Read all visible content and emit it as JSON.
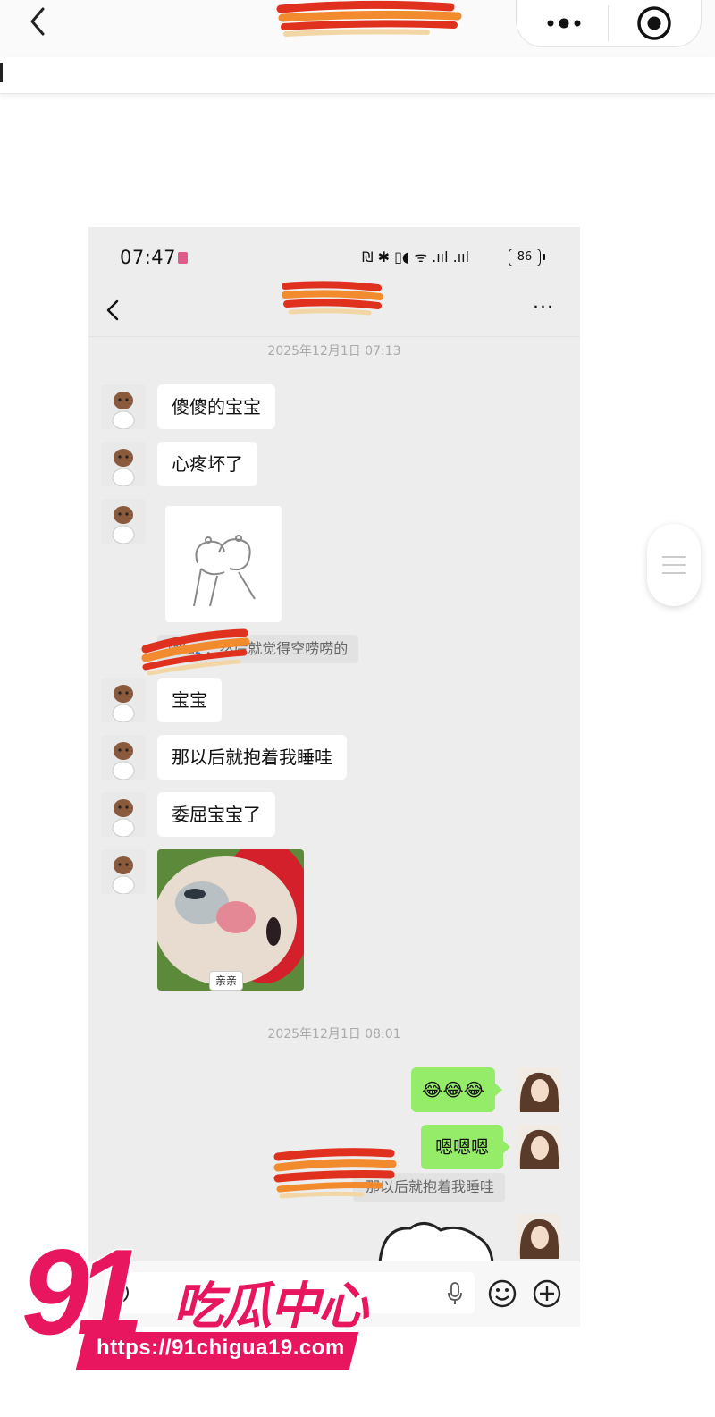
{
  "outer": {
    "capsule_more": "•●•",
    "colors": {
      "redact_red": "#e0301e",
      "redact_orange": "#f28a2e",
      "redact_cream": "#f3d6a6"
    }
  },
  "status_bar": {
    "time": "07:47",
    "icons_text": "₪ ✱ ▯◖ ᯤ .ııl .ııl",
    "battery": "86"
  },
  "chat_header": {
    "more_label": "···"
  },
  "timestamps": [
    "2025年12月1日 07:13",
    "2025年12月1日 08:01"
  ],
  "messages": {
    "m1": "傻傻的宝宝",
    "m2": "心疼坏了",
    "quote1": "然后就觉得空唠唠的",
    "quote1_prefix": "阿la",
    "quote1_sep": "：",
    "m3": "宝宝",
    "m4": "那以后就抱着我睡哇",
    "m5": "委屈宝宝了",
    "kiss_label": "亲亲",
    "my1": "😂😂😂",
    "my2": "嗯嗯嗯",
    "quote2": "那以后就抱着我睡哇"
  },
  "watermark": {
    "number": "91",
    "brand": "吃瓜中心",
    "url": "https://91chigua19.com"
  },
  "colors": {
    "my_bubble": "#95ec69",
    "chat_bg": "#ededed",
    "watermark": "#e8165e"
  }
}
